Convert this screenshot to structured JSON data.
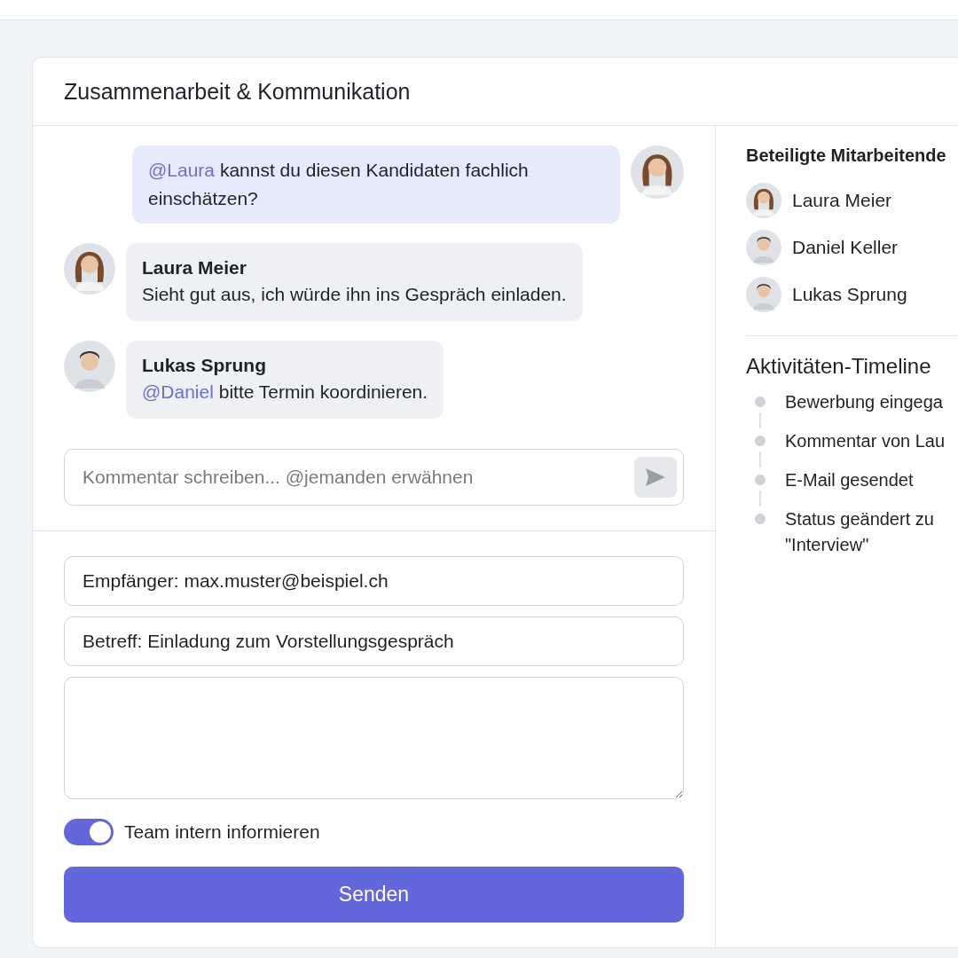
{
  "card": {
    "title": "Zusammenarbeit & Kommunikation"
  },
  "messages": [
    {
      "kind": "own",
      "avatar": {
        "kind": "woman"
      },
      "mention": "@Laura",
      "text": "kannst du diesen Kandidaten fachlich einschätzen?"
    },
    {
      "kind": "other",
      "avatar": {
        "kind": "woman"
      },
      "author": "Laura Meier",
      "text": "Sieht gut aus, ich würde ihn ins Gespräch einladen."
    },
    {
      "kind": "other",
      "avatar": {
        "kind": "man"
      },
      "author": "Lukas Sprung",
      "mention": "@Daniel",
      "text": "bitte Termin koordinieren."
    }
  ],
  "comment": {
    "placeholder": "Kommentar schreiben... @jemanden erwähnen"
  },
  "email": {
    "recipient": "Empfänger: max.muster@beispiel.ch",
    "subject": "Betreff: Einladung zum Vorstellungsgespräch",
    "notify": {
      "label": "Team intern informieren",
      "on": true
    },
    "send": "Senden"
  },
  "participants": {
    "title": "Beteiligte Mitarbeitende",
    "items": [
      {
        "name": "Laura Meier",
        "avatar": {
          "kind": "woman"
        }
      },
      {
        "name": "Daniel Keller",
        "avatar": {
          "kind": "man"
        }
      },
      {
        "name": "Lukas Sprung",
        "avatar": {
          "kind": "man"
        }
      }
    ]
  },
  "timeline": {
    "title": "Aktivitäten-Timeline",
    "items": [
      "Bewerbung eingega",
      "Kommentar von Lau",
      "E-Mail gesendet",
      "Status geändert zu \"Interview\""
    ]
  }
}
